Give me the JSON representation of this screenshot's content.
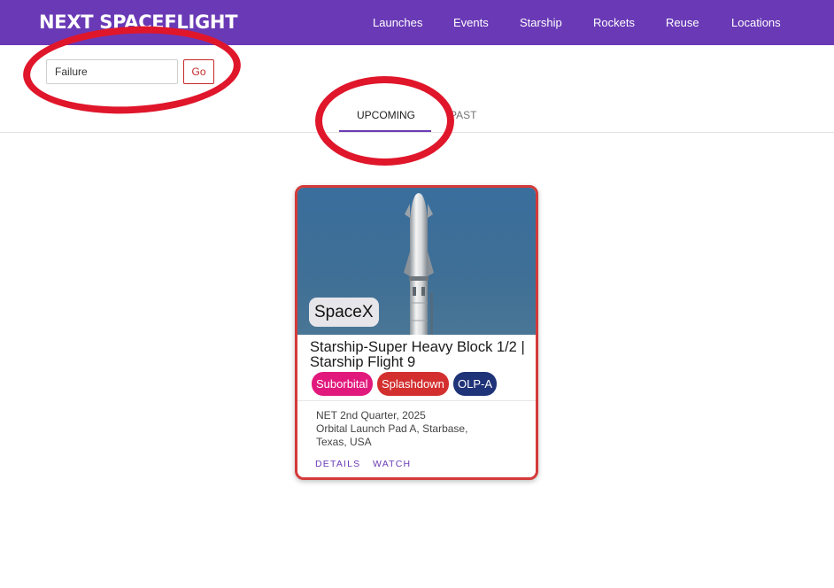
{
  "header": {
    "logo": "NEXT SPACEFLIGHT",
    "nav": [
      "Launches",
      "Events",
      "Starship",
      "Rockets",
      "Reuse",
      "Locations"
    ]
  },
  "search": {
    "value": "Failure",
    "go_label": "Go"
  },
  "tabs": {
    "upcoming": "UPCOMING",
    "past": "PAST",
    "active": "UPCOMING"
  },
  "launch_card": {
    "agency": "SpaceX",
    "title": "Starship-Super Heavy Block 1/2 | Starship Flight 9",
    "chips": [
      {
        "label": "Suborbital",
        "color": "#e2197d"
      },
      {
        "label": "Splashdown",
        "color": "#d32f2f"
      },
      {
        "label": "OLP-A",
        "color": "#1f3378"
      }
    ],
    "date": "NET 2nd Quarter, 2025",
    "location_line1": "Orbital Launch Pad A, Starbase,",
    "location_line2": "Texas, USA",
    "details_label": "DETAILS",
    "watch_label": "WATCH"
  },
  "colors": {
    "brand_purple": "#6a3ab6",
    "card_border": "#d43a3a",
    "annotation_red": "#e0162b"
  }
}
